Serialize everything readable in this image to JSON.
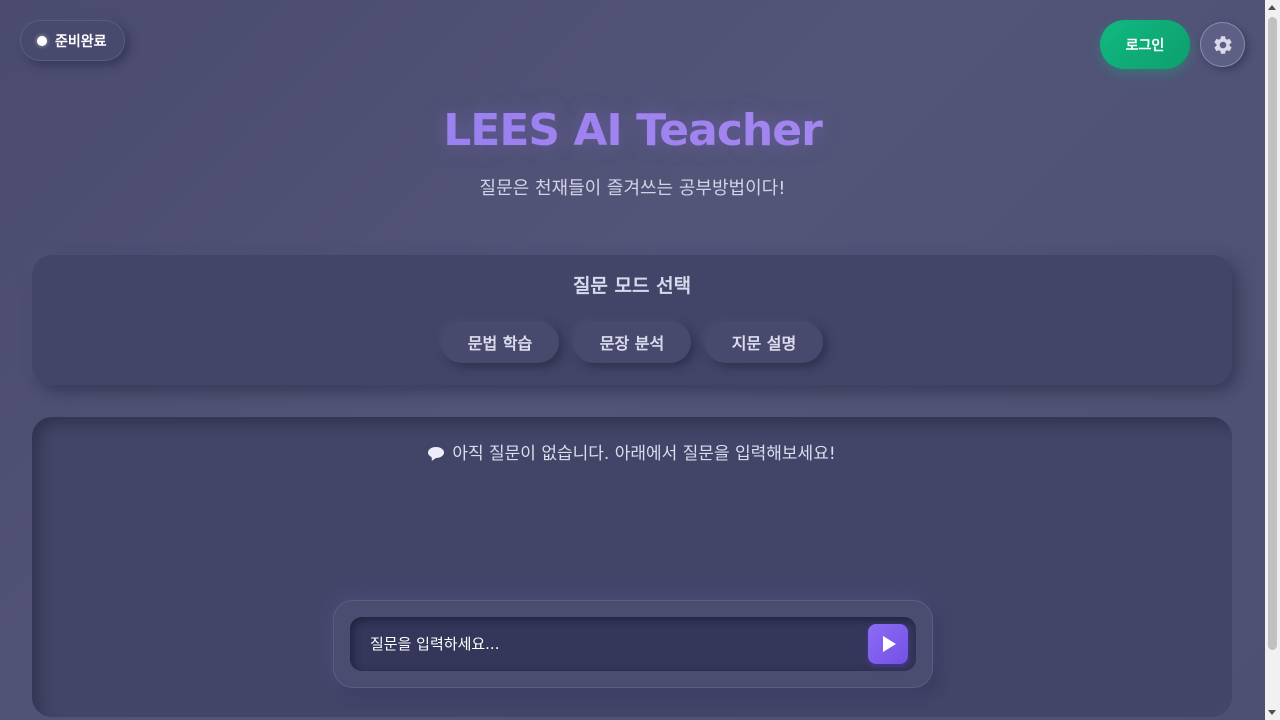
{
  "status": {
    "label": "준비완료",
    "dot_color": "#ffffff"
  },
  "header": {
    "login_label": "로그인",
    "settings_icon": "gear-icon",
    "title": "LEES AI Teacher",
    "subtitle": "질문은 천재들이 즐겨쓰는 공부방법이다!"
  },
  "mode_panel": {
    "title": "질문 모드 선택",
    "modes": [
      {
        "label": "문법 학습"
      },
      {
        "label": "문장 분석"
      },
      {
        "label": "지문 설명"
      }
    ]
  },
  "chat": {
    "empty_icon": "speech-bubble-icon",
    "empty_message": "아직 질문이 없습니다. 아래에서 질문을 입력해보세요!"
  },
  "input": {
    "placeholder": "질문을 입력하세요...",
    "value": "",
    "send_icon": "play-icon"
  },
  "colors": {
    "background": "#4e5073",
    "panel": "#434568",
    "accent_green": "#10b981",
    "accent_purple": "#8b6cf4",
    "title_gradient_start": "#8f7df0",
    "title_gradient_end": "#b590f0"
  }
}
